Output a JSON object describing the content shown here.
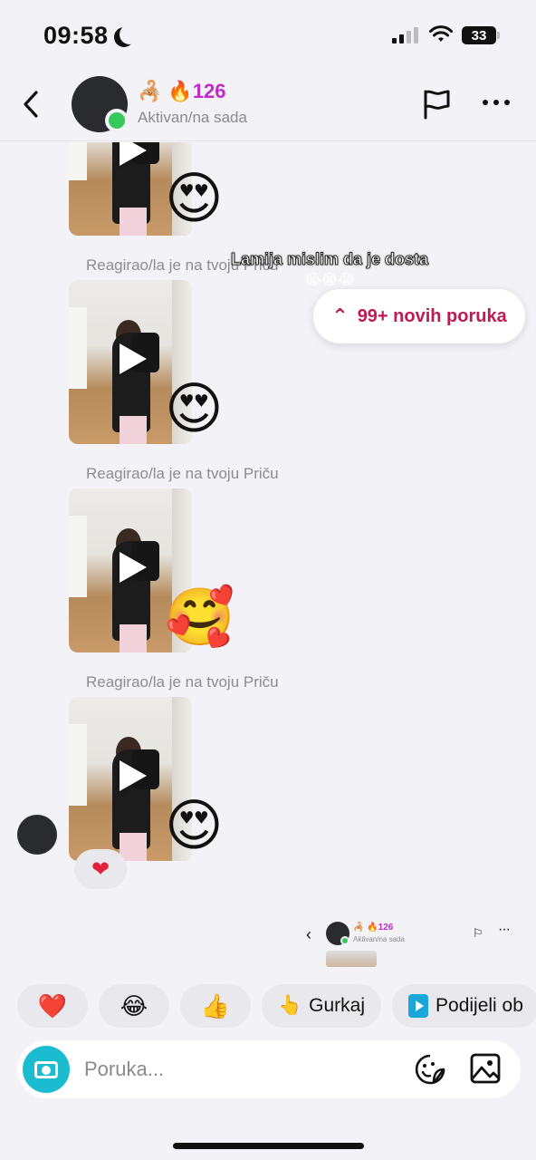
{
  "status_bar": {
    "time": "09:58",
    "battery": "33"
  },
  "header": {
    "name_emoji": "🦂",
    "streak_icon": "🔥",
    "streak_count": "126",
    "status": "Aktivan/na sada"
  },
  "chat": {
    "caption_line1": "Lamija mislim da je dosta",
    "caption_line2": "😭😭😭",
    "new_messages": "99+ novih poruka",
    "reacted_label": "Reagirao/la je na tvoju Priču",
    "stories": [
      {
        "reaction": "😍"
      },
      {
        "reaction": "😍"
      },
      {
        "reaction": "🥰"
      },
      {
        "reaction": "😍"
      }
    ],
    "heart_reaction": "❤"
  },
  "mini_preview": {
    "back": "‹",
    "streak": "🦂 🔥126",
    "status": "Aktivan/na sada",
    "flag": "⚐",
    "more": "···"
  },
  "quick_replies": {
    "heart": "❤️",
    "laugh": "😂",
    "thumbs": "👍",
    "nudge_icon": "👆",
    "nudge_label": "Gurkaj",
    "share_label": "Podijeli ob"
  },
  "composer": {
    "placeholder": "Poruka..."
  },
  "colors": {
    "accent_pink": "#c01a55",
    "streak": "#c02cc7",
    "online": "#35c85a",
    "camera": "#1cbcd0"
  }
}
